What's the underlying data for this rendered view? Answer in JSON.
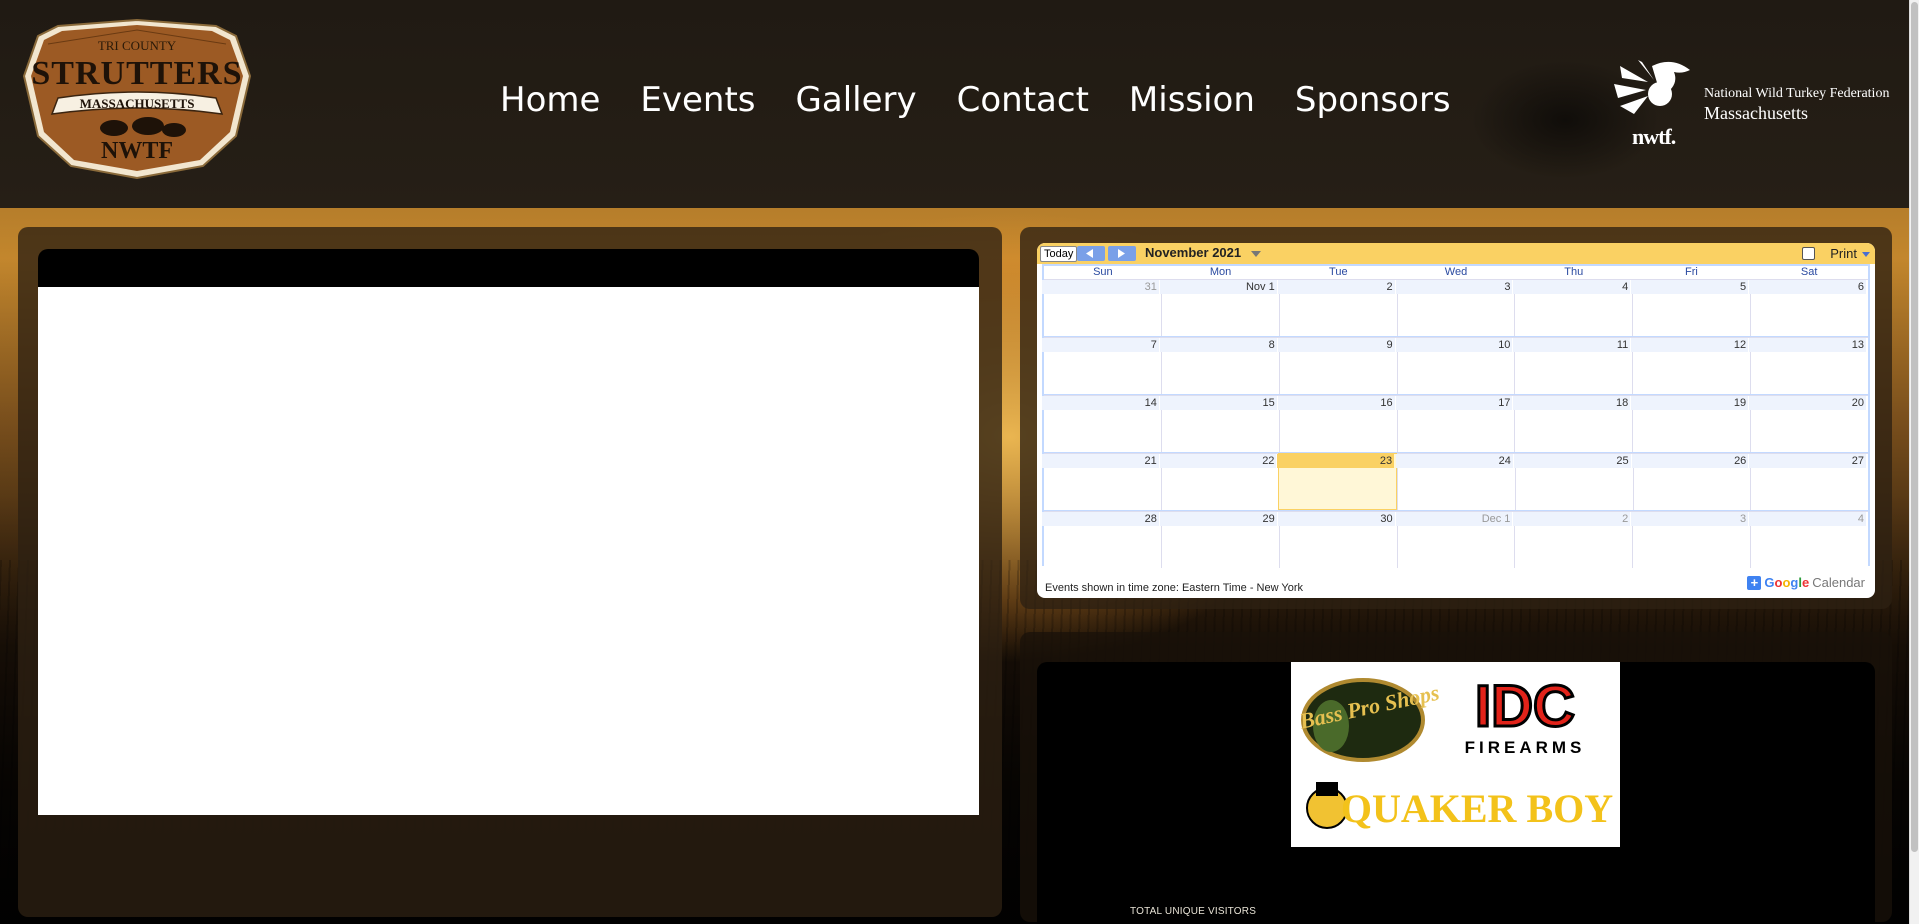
{
  "header": {
    "logo": {
      "line1": "TRI COUNTY",
      "line2": "STRUTTERS",
      "line3": "MASSACHUSETTS",
      "line4": "NWTF"
    },
    "nav": [
      "Home",
      "Events",
      "Gallery",
      "Contact",
      "Mission",
      "Sponsors"
    ],
    "partner": {
      "brand": "nwtf.",
      "line1": "National Wild Turkey Federation",
      "line2": "Massachusetts"
    }
  },
  "calendar": {
    "today_label": "Today",
    "title": "November 2021",
    "print_label": "Print",
    "days_of_week": [
      "Sun",
      "Mon",
      "Tue",
      "Wed",
      "Thu",
      "Fri",
      "Sat"
    ],
    "weeks": [
      [
        "31",
        "Nov 1",
        "2",
        "3",
        "4",
        "5",
        "6"
      ],
      [
        "7",
        "8",
        "9",
        "10",
        "11",
        "12",
        "13"
      ],
      [
        "14",
        "15",
        "16",
        "17",
        "18",
        "19",
        "20"
      ],
      [
        "21",
        "22",
        "23",
        "24",
        "25",
        "26",
        "27"
      ],
      [
        "28",
        "29",
        "30",
        "Dec 1",
        "2",
        "3",
        "4"
      ]
    ],
    "today_cell": "23",
    "timezone_note": "Events shown in time zone: Eastern Time - New York",
    "google_brand": "Google",
    "calendar_word": "Calendar",
    "colors": {
      "bar": "#fad163",
      "today": "#fff7d7",
      "header_text": "#2a4aa0"
    }
  },
  "sponsors": [
    "Bass Pro Shops",
    "IDC",
    "FIREARMS",
    "QUAKER BOY"
  ],
  "footer": {
    "visitors_label": "TOTAL UNIQUE VISITORS"
  }
}
